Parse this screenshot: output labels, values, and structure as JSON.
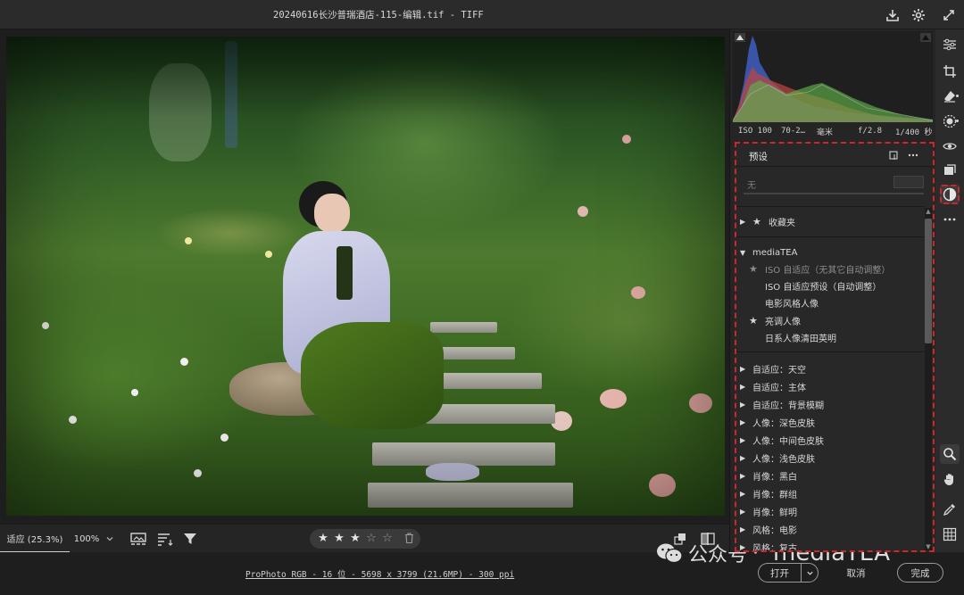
{
  "window": {
    "title": "20240616长沙普瑞酒店-115-编辑.tif -  TIFF"
  },
  "icons": {
    "save": "download-icon",
    "settings": "gear-icon",
    "fullscreen": "expand-icon"
  },
  "bottom_toolbar": {
    "zoom_fit_label": "适应 (25.3%)",
    "zoom_100_label": "100%",
    "rating": 3,
    "rating_max": 5
  },
  "status": {
    "file_info": "ProPhoto RGB - 16 位 - 5698 x 3799 (21.6MP) - 300 ppi",
    "open_label": "打开",
    "cancel_label": "取消",
    "done_label": "完成",
    "watermark_prefix": "公众号",
    "watermark_dot": "·",
    "watermark_name": "mediaTEA"
  },
  "exif": {
    "iso": "ISO 100",
    "focal": "70-2…",
    "focal_unit": "毫米",
    "aperture": "f/2.8",
    "shutter": "1/400 秒"
  },
  "presets": {
    "title": "预设",
    "amount_label": "无",
    "favorites": "收藏夹",
    "group_name": "mediaTEA",
    "group_items": [
      {
        "label": "ISO 自适应（无其它自动调整）",
        "starred": true,
        "dim": true
      },
      {
        "label": "ISO 自适应预设（自动调整）",
        "starred": false,
        "dim": false
      },
      {
        "label": "电影风格人像",
        "starred": false,
        "dim": false
      },
      {
        "label": "亮调人像",
        "starred": true,
        "dim": false
      },
      {
        "label": "日系人像清田英明",
        "starred": false,
        "dim": false
      }
    ],
    "collapsed_groups": [
      "自适应：天空",
      "自适应：主体",
      "自适应：背景模糊",
      "人像：深色皮肤",
      "人像：中间色皮肤",
      "人像：浅色皮肤",
      "肖像：黑白",
      "肖像：群组",
      "肖像：鲜明",
      "风格：电影",
      "风格：复古"
    ]
  },
  "colors": {
    "accent_red": "#d0262b",
    "panel_bg": "#282828",
    "histogram_blue": "#3f5fbf",
    "histogram_red": "#c0453f",
    "histogram_green": "#5fb04a"
  }
}
